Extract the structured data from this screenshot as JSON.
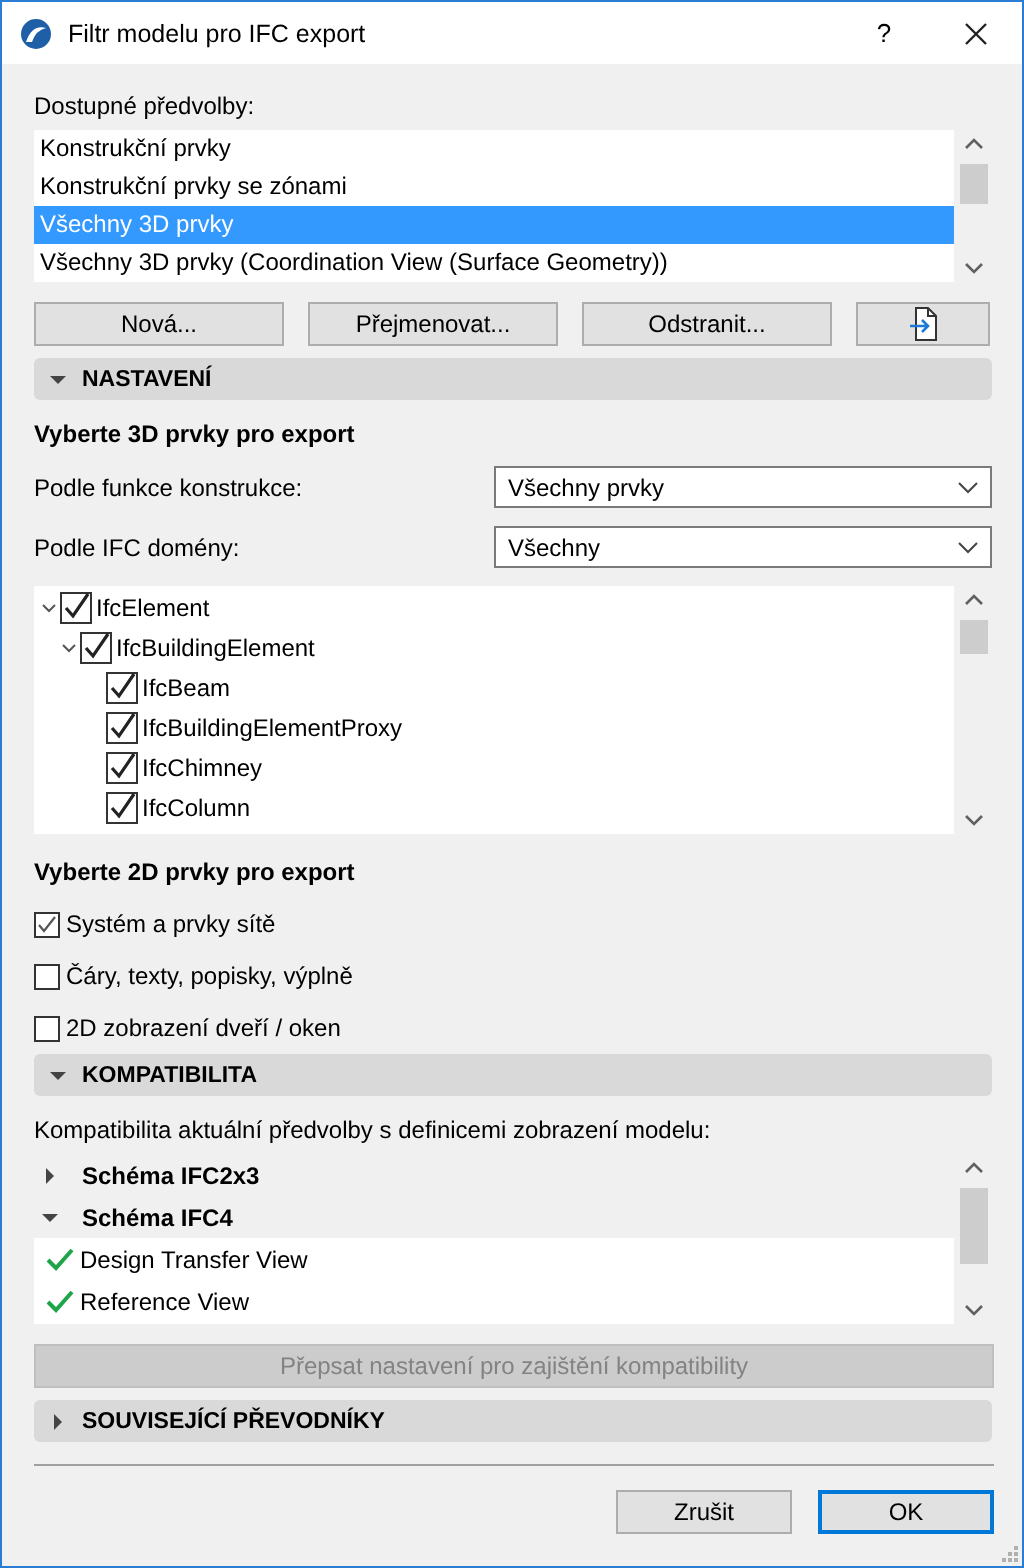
{
  "window": {
    "title": "Filtr modelu pro IFC export",
    "help": "?"
  },
  "presets": {
    "label": "Dostupné předvolby:",
    "items": [
      {
        "label": "Konstrukční prvky",
        "selected": false
      },
      {
        "label": "Konstrukční prvky se zónami",
        "selected": false
      },
      {
        "label": "Všechny 3D prvky",
        "selected": true
      },
      {
        "label": "Všechny 3D prvky (Coordination View (Surface Geometry))",
        "selected": false
      }
    ],
    "buttons": [
      "Nová...",
      "Přejmenovat...",
      "Odstranit..."
    ]
  },
  "settings": {
    "title": "NASTAVENÍ",
    "expanded": true,
    "heading_3d": "Vyberte 3D prvky pro export",
    "filters": [
      {
        "label": "Podle funkce konstrukce:",
        "value": "Všechny prvky"
      },
      {
        "label": "Podle IFC domény:",
        "value": "Všechny"
      }
    ],
    "tree": [
      {
        "label": "IfcElement",
        "checked": true,
        "expanded": true,
        "children": [
          {
            "label": "IfcBuildingElement",
            "checked": true,
            "expanded": true,
            "children": [
              {
                "label": "IfcBeam",
                "checked": true
              },
              {
                "label": "IfcBuildingElementProxy",
                "checked": true
              },
              {
                "label": "IfcChimney",
                "checked": true
              },
              {
                "label": "IfcColumn",
                "checked": true
              }
            ]
          }
        ]
      }
    ],
    "heading_2d": "Vyberte 2D prvky pro export",
    "options_2d": [
      {
        "label": "Systém a prvky sítě",
        "checked": true
      },
      {
        "label": "Čáry, texty, popisky, výplně",
        "checked": false
      },
      {
        "label": "2D zobrazení dveří / oken",
        "checked": false
      }
    ]
  },
  "compatibility": {
    "title": "KOMPATIBILITA",
    "expanded": true,
    "description": "Kompatibilita aktuální předvolby s definicemi zobrazení modelu:",
    "schemas": [
      {
        "label": "Schéma IFC2x3",
        "expanded": false
      },
      {
        "label": "Schéma IFC4",
        "expanded": true,
        "views": [
          {
            "label": "Design Transfer View",
            "compatible": true
          },
          {
            "label": "Reference View",
            "compatible": true
          }
        ]
      }
    ],
    "override_button": {
      "label": "Přepsat nastavení pro zajištění kompatibility",
      "disabled": true
    }
  },
  "converters": {
    "title": "SOUVISEJÍCÍ PŘEVODNÍKY",
    "expanded": false
  },
  "footer_buttons": [
    {
      "label": "Zrušit",
      "default": false
    },
    {
      "label": "OK",
      "default": true
    }
  ]
}
